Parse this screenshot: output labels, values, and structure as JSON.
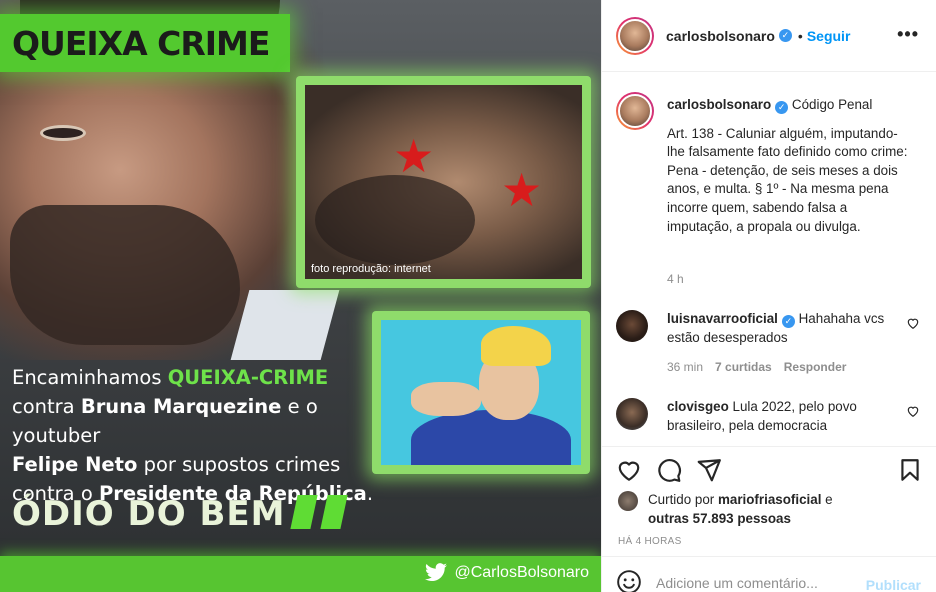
{
  "post_image": {
    "banner": "QUEIXA CRIME",
    "photo1_caption": "foto reprodução: internet",
    "text": {
      "line1_a": "Encaminhamos ",
      "line1_b": "QUEIXA-CRIME",
      "line2_a": "contra ",
      "line2_b": "Bruna Marquezine",
      "line2_c": " e o youtuber",
      "line3_a": "Felipe Neto",
      "line3_b": " por supostos crimes",
      "line4_a": "contra o ",
      "line4_b": "Presidente da República",
      "line4_c": "."
    },
    "slogan": "ÓDIO DO BEM",
    "handle": "@CarlosBolsonaro",
    "accent_color": "#57c531"
  },
  "header": {
    "username": "carlosbolsonaro",
    "dot": "•",
    "follow_label": "Seguir",
    "more_label": "•••"
  },
  "caption": {
    "author": "carlosbolsonaro",
    "title": "Código Penal",
    "text": "Art. 138 - Caluniar alguém, imputando-lhe falsamente fato definido como crime: Pena - detenção, de seis meses a dois anos, e multa. § 1º - Na mesma pena incorre quem, sabendo falsa a imputação, a propala ou divulga.",
    "time": "4 h"
  },
  "comments": [
    {
      "author": "luisnavarrooficial",
      "text": "Hahahaha vcs estão desesperados",
      "time": "36 min",
      "likes": "7 curtidas",
      "reply": "Responder"
    },
    {
      "author": "clovisgeo",
      "text": "Lula 2022, pelo povo brasileiro, pela democracia"
    }
  ],
  "likes": {
    "prefix": "Curtido por ",
    "user": "mariofriasoficial",
    "middle": " e",
    "others": "outras 57.893 pessoas"
  },
  "posted": "HÁ 4 HORAS",
  "add_comment": {
    "placeholder": "Adicione um comentário...",
    "publish": "Publicar"
  }
}
